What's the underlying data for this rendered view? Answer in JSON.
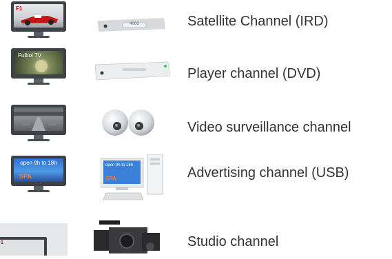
{
  "channels": [
    {
      "label": "Satellite Channel (IRD)",
      "screen_text": "F1",
      "device_text": "4000",
      "device_icon": "satellite-receiver-icon"
    },
    {
      "label": "Player channel (DVD)",
      "screen_text": "Fulbol TV",
      "device_icon": "dvd-player-icon"
    },
    {
      "label": "Video surveillance channel",
      "device_icon": "surveillance-camera-icon"
    },
    {
      "label": "Advertising channel (USB)",
      "screen_text": "open 9h to 18h",
      "device_icon": "desktop-computer-icon"
    },
    {
      "label": "Studio channel",
      "device_icon": "video-camera-icon"
    }
  ]
}
